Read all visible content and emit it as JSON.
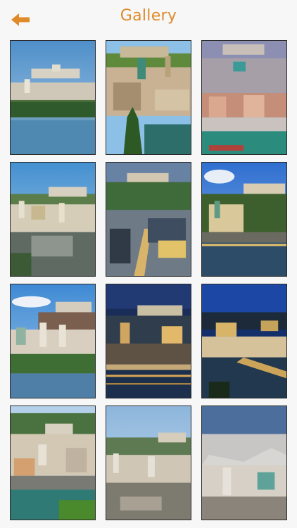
{
  "header": {
    "title": "Gallery",
    "back_icon": "arrow-left-icon",
    "accent_color": "#e08a2a"
  },
  "gallery": {
    "photo_count": 12
  }
}
